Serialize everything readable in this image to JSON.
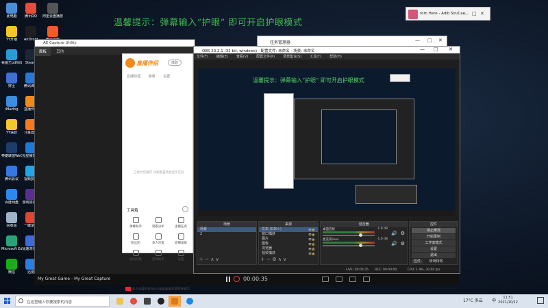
{
  "desktop": {
    "banner": "温馨提示：弹幕输入“护眼” 即可开启护眼模式",
    "icons_left": [
      {
        "label": "此电脑",
        "color": "#4a8fd6"
      },
      {
        "label": "YY开播",
        "color": "#f5c62b"
      },
      {
        "label": "看图王pdf阅读器",
        "color": "#2b9bd6"
      },
      {
        "label": "好压",
        "color": "#3e6fd1"
      },
      {
        "label": "iMazing",
        "color": "#3c8de0"
      },
      {
        "label": "YY语音",
        "color": "#f5c62b"
      },
      {
        "label": "英雄联盟WeGame版",
        "color": "#1d3b6b"
      },
      {
        "label": "腾讯会议",
        "color": "#3578e5"
      },
      {
        "label": "百度网盘",
        "color": "#2d89ef"
      },
      {
        "label": "回收站",
        "color": "#9fb3c8"
      },
      {
        "label": "Microsoft Edge",
        "color": "#2aa37a"
      },
      {
        "label": "微信",
        "color": "#1aad19"
      }
    ],
    "icons_col2": [
      {
        "label": "腾讯QQ",
        "color": "#e84c3d"
      },
      {
        "label": "AirDroid",
        "color": "#1f1f1f"
      },
      {
        "label": "Steam",
        "color": "#1b2838"
      },
      {
        "label": "腾讯课堂",
        "color": "#2a78d6"
      },
      {
        "label": "直播伴侣",
        "color": "#f08a1c"
      },
      {
        "label": "斗鱼直播",
        "color": "#f6791f"
      },
      {
        "label": "恒星播放器",
        "color": "#1d7ad6"
      },
      {
        "label": "视频剪辑",
        "color": "#22a6e8"
      },
      {
        "label": "游戏加速器",
        "color": "#5c2d91"
      },
      {
        "label": "一键录屏",
        "color": "#e0452f"
      },
      {
        "label": "极速浏览器",
        "color": "#3f6ad8"
      },
      {
        "label": "迅雷",
        "color": "#2d7ce0"
      }
    ],
    "icons_col3": [
      {
        "label": "阿里云盘播放器",
        "color": "#555"
      },
      {
        "label": "腾讯视频",
        "color": "#f25a2a"
      }
    ]
  },
  "mini_window": {
    "title": "rom Here - Adib Sin/Cae",
    "minimize": "—",
    "maximize": "□",
    "close": "✕"
  },
  "back_window": {
    "title": "任务管理器",
    "minimize": "—",
    "maximize": "□",
    "close": "✕"
  },
  "ae_window": {
    "title": "AE Capture Utility",
    "tabs": [
      "面板",
      "其他"
    ],
    "game_label": "My Great Game - My Great Capture",
    "timer": "00:00:35"
  },
  "helper": {
    "brand": "直播伴侣",
    "version": "体验",
    "tabs": [
      "直播助理",
      "弹幕",
      "设置"
    ],
    "empty_msg": "已经为您推荐 功能配置将会显示在此",
    "tools_label": "工具箱",
    "tools": [
      "弹幕助手",
      "观看分析",
      "主播任务",
      "粉丝团",
      "多人连麦",
      "直播录屏",
      "虚拟形象",
      "游戏助手",
      "设置"
    ],
    "footer": "多人连麦已支持4人连麦新版本暂时开放中"
  },
  "obs": {
    "title": "OBS 23.2.1 (32-bit, windows) - 配置文件: 未命名 - 场景: 未命名",
    "menu": [
      "文件(F)",
      "编辑(E)",
      "查看(V)",
      "配置文件(P)",
      "场景集合(S)",
      "工具(T)",
      "帮助(H)"
    ],
    "preview_banner": "温馨提示：弹幕输入“护眼” 即可开启护眼模式",
    "scenes_header": "场景",
    "scenes": [
      "场景",
      "2"
    ],
    "sources_header": "来源",
    "sources": [
      "文本 (GDI+)",
      "窗口捕获",
      "图片",
      "图像",
      "浏览器",
      "视频捕获"
    ],
    "mixer_header": "混音器",
    "mixer": [
      {
        "name": "桌面音频",
        "db": "-1.0 dB",
        "level": 0.72
      },
      {
        "name": "麦克风/Aux",
        "db": "-1.0 dB",
        "level": 0.72
      }
    ],
    "controls_header": "控件",
    "controls": [
      "停止推流",
      "开始录制",
      "工作室模式",
      "设置",
      "退出"
    ],
    "controls_bottom": [
      "控件",
      "转场特效"
    ],
    "status": {
      "live": "LIVE: 00:00:35",
      "rec": "REC: 00:00:00",
      "cpu": "CPU: 1.9%, 30.00 fps"
    }
  },
  "taskbar": {
    "search_placeholder": "在这里输入你要搜索的内容",
    "weather": "17°C 多云",
    "ime": "中",
    "time": "11:51",
    "date": "2021/10/12"
  }
}
